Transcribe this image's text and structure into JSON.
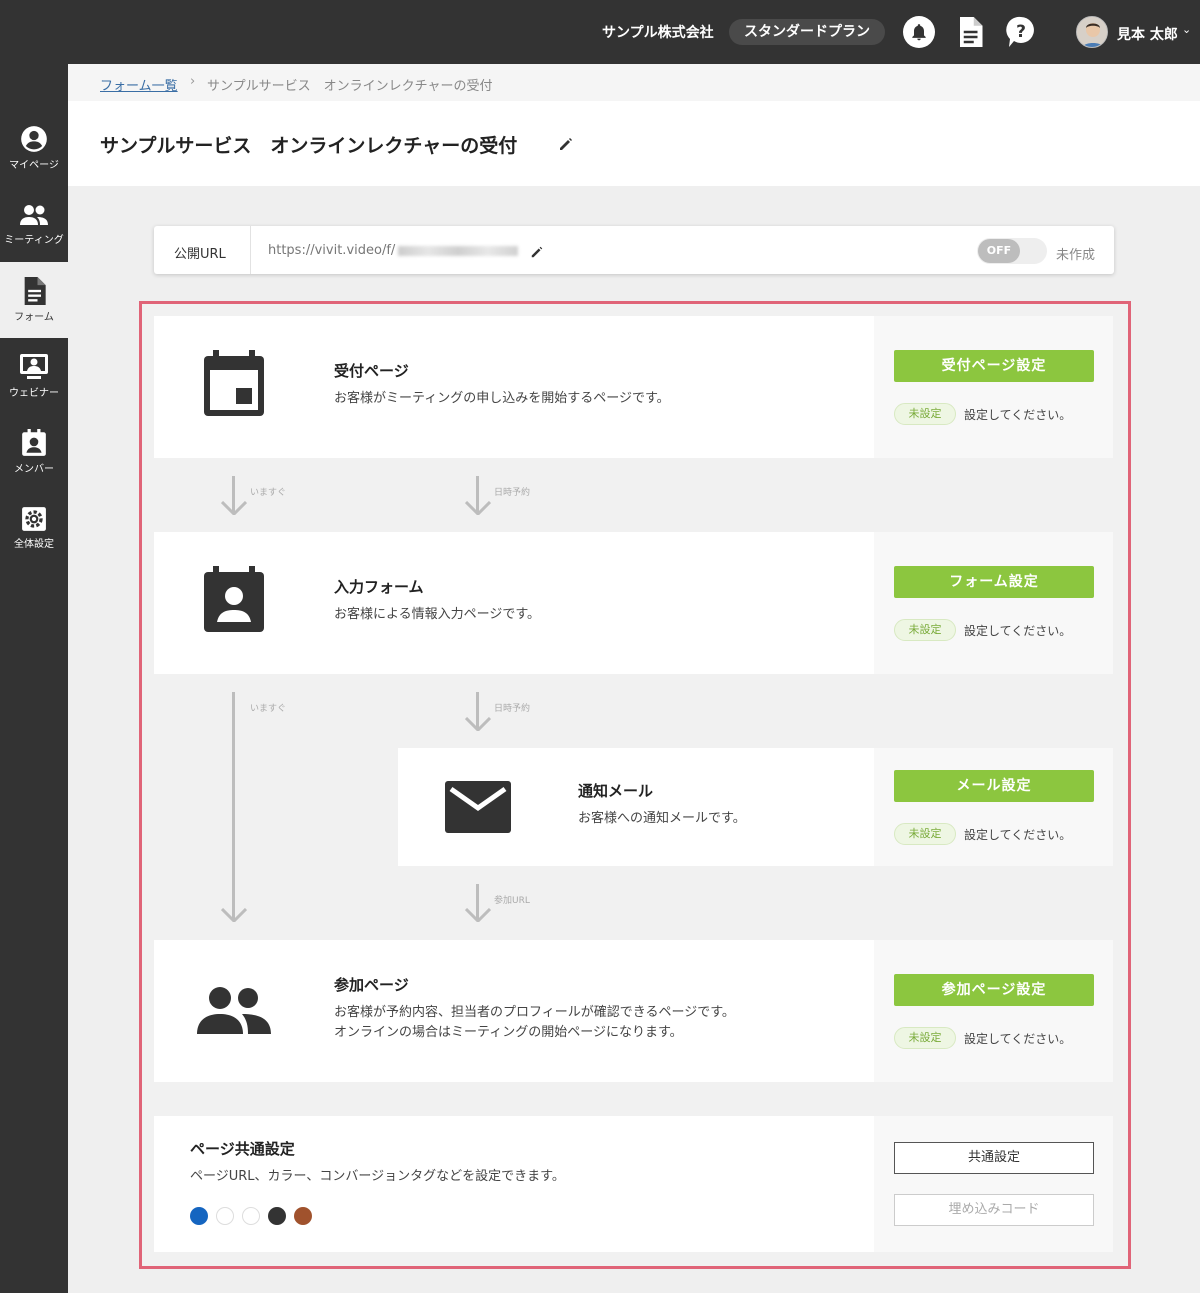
{
  "topbar": {
    "company": "サンプル株式会社",
    "plan": "スタンダードプラン",
    "icons": [
      "bell-icon",
      "document-icon",
      "help-icon"
    ],
    "user_name": "見本 太郎"
  },
  "sidebar": {
    "items": [
      {
        "label": "マイページ",
        "icon": "account-icon"
      },
      {
        "label": "ミーティング",
        "icon": "people-icon"
      },
      {
        "label": "フォーム",
        "icon": "form-icon",
        "active": true
      },
      {
        "label": "ウェビナー",
        "icon": "webinar-icon"
      },
      {
        "label": "メンバー",
        "icon": "member-icon"
      },
      {
        "label": "全体設定",
        "icon": "settings-icon"
      }
    ]
  },
  "breadcrumb": {
    "link": "フォーム一覧",
    "separator": "›",
    "current": "サンプルサービス　オンラインレクチャーの受付"
  },
  "page": {
    "title": "サンプルサービス　オンラインレクチャーの受付"
  },
  "url": {
    "label": "公開URL",
    "value": "https://vivit.video/f/",
    "toggle": "OFF",
    "status": "未作成"
  },
  "flow": {
    "reception": {
      "title": "受付ページ",
      "desc": "お客様がミーティングの申し込みを開始するページです。",
      "button": "受付ページ設定",
      "badge": "未設定",
      "note": "設定してください。"
    },
    "arrows1": {
      "now": "いますぐ",
      "reserve": "日時予約"
    },
    "form": {
      "title": "入力フォーム",
      "desc": "お客様による情報入力ページです。",
      "button": "フォーム設定",
      "badge": "未設定",
      "note": "設定してください。"
    },
    "arrows2": {
      "now": "いますぐ",
      "reserve": "日時予約"
    },
    "mail": {
      "title": "通知メール",
      "desc": "お客様への通知メールです。",
      "button": "メール設定",
      "badge": "未設定",
      "note": "設定してください。"
    },
    "arrows3": {
      "join_url": "参加URL"
    },
    "join": {
      "title": "参加ページ",
      "desc1": "お客様が予約内容、担当者のプロフィールが確認できるページです。",
      "desc2": "オンラインの場合はミーティングの開始ページになります。",
      "button": "参加ページ設定",
      "badge": "未設定",
      "note": "設定してください。"
    },
    "common": {
      "title": "ページ共通設定",
      "desc": "ページURL、カラー、コンバージョンタグなどを設定できます。",
      "colors": [
        "#1565c0",
        "#ffffff",
        "#ffffff",
        "#333333",
        "#a0522d"
      ],
      "button": "共通設定",
      "embed_button": "埋め込みコード"
    }
  },
  "colors": {
    "accent_green": "#8cc63f",
    "frame_red": "#e06478",
    "dark": "#333333"
  }
}
